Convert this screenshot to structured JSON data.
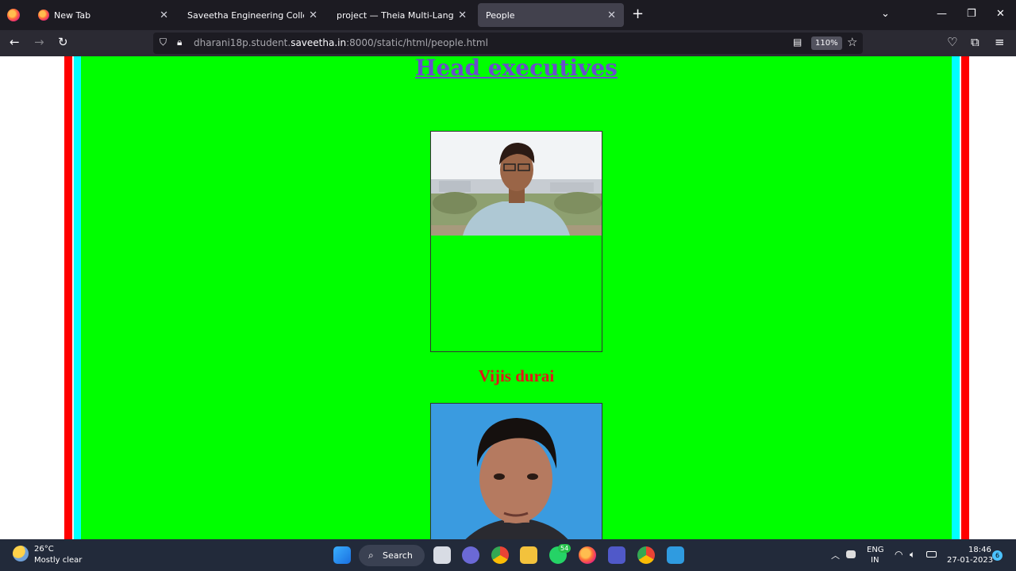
{
  "browser": {
    "tabs": [
      {
        "label": "New Tab",
        "active": false
      },
      {
        "label": "Saveetha Engineering College",
        "active": false
      },
      {
        "label": "project — Theia Multi-Language Ex",
        "active": false
      },
      {
        "label": "People",
        "active": true
      }
    ],
    "url_prefix": "dharani18p.student.",
    "url_domain": "saveetha.in",
    "url_suffix": ":8000/static/html/people.html",
    "zoom": "110%"
  },
  "page": {
    "heading": "Head executives",
    "people": [
      {
        "name": "Vijis durai",
        "photo": "person-photo-1"
      },
      {
        "name": "",
        "photo": "person-photo-2"
      }
    ],
    "colors": {
      "panel": "#00ff00",
      "border_outer": "#ff0000",
      "border_inner": "#00ffff",
      "heading": "#6a4dcc",
      "name": "#e01818"
    }
  },
  "taskbar": {
    "weather_temp": "26°C",
    "weather_desc": "Mostly clear",
    "search_label": "Search",
    "whatsapp_badge": "54",
    "lang_top": "ENG",
    "lang_bottom": "IN",
    "time": "18:46",
    "date": "27-01-2023",
    "notifications": "6"
  }
}
